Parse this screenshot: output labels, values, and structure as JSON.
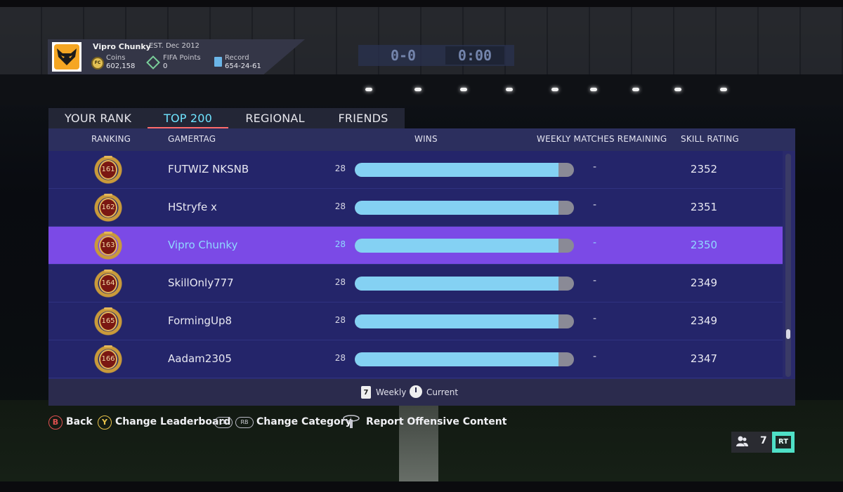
{
  "profile": {
    "name": "Vipro Chunky",
    "established": "EST. Dec 2012",
    "coins_label": "Coins",
    "coins_value": "602,158",
    "coin_icon_text": "FC",
    "fifa_points_label": "FIFA Points",
    "fifa_points_value": "0",
    "record_label": "Record",
    "record_value": "654-24-61"
  },
  "scoreboard": {
    "left": "0-0",
    "right": "0:00"
  },
  "tabs": [
    {
      "label": "YOUR RANK",
      "active": false
    },
    {
      "label": "TOP 200",
      "active": true
    },
    {
      "label": "REGIONAL",
      "active": false
    },
    {
      "label": "FRIENDS",
      "active": false
    }
  ],
  "table": {
    "headers": {
      "ranking": "RANKING",
      "gamertag": "GAMERTAG",
      "wins": "WINS",
      "weekly_matches_remaining": "WEEKLY MATCHES REMAINING",
      "skill_rating": "SKILL RATING"
    },
    "rows": [
      {
        "rank": "161",
        "gamertag": "FUTWIZ NKSNB",
        "wins": "28",
        "wins_fraction": 0.93,
        "weekly_remaining": "-",
        "skill_rating": "2352",
        "selected": false
      },
      {
        "rank": "162",
        "gamertag": "HStryfe x",
        "wins": "28",
        "wins_fraction": 0.93,
        "weekly_remaining": "-",
        "skill_rating": "2351",
        "selected": false
      },
      {
        "rank": "163",
        "gamertag": "Vipro Chunky",
        "wins": "28",
        "wins_fraction": 0.93,
        "weekly_remaining": "-",
        "skill_rating": "2350",
        "selected": true
      },
      {
        "rank": "164",
        "gamertag": "SkillOnly777",
        "wins": "28",
        "wins_fraction": 0.93,
        "weekly_remaining": "-",
        "skill_rating": "2349",
        "selected": false
      },
      {
        "rank": "165",
        "gamertag": "FormingUp8",
        "wins": "28",
        "wins_fraction": 0.93,
        "weekly_remaining": "-",
        "skill_rating": "2349",
        "selected": false
      },
      {
        "rank": "166",
        "gamertag": "Aadam2305",
        "wins": "28",
        "wins_fraction": 0.93,
        "weekly_remaining": "-",
        "skill_rating": "2347",
        "selected": false
      }
    ],
    "footer": {
      "calendar_number": "7",
      "weekly": "Weekly",
      "current": "Current"
    }
  },
  "hints": {
    "back_button": "B",
    "back_label": "Back",
    "leaderboard_button": "Y",
    "leaderboard_label": "Change Leaderboard",
    "lb": "LB",
    "rb": "RB",
    "category_label": "Change Category",
    "report_stick": "L",
    "report_label": "Report Offensive Content"
  },
  "friends": {
    "count": "7",
    "trigger": "RT"
  },
  "colors": {
    "accent_cyan": "#6fe4ff",
    "selected_row": "#7b4ae6",
    "bar_fill": "#84d1f3",
    "back_button": "#e05050",
    "y_button": "#e8c24a",
    "rt": "#4fe0c7"
  }
}
